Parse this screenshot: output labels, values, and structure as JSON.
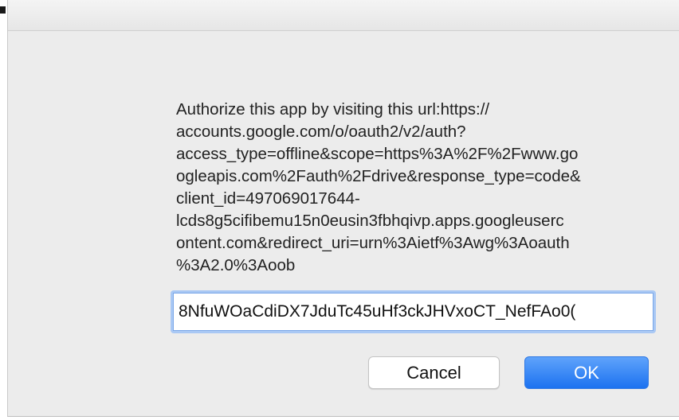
{
  "dialog": {
    "message": "Authorize this app by visiting this url:https://\naccounts.google.com/o/oauth2/v2/auth?\naccess_type=offline&scope=https%3A%2F%2Fwww.go\nogleapis.com%2Fauth%2Fdrive&response_type=code&\nclient_id=497069017644-\nlcds8g5cifibemu15n0eusin3fbhqivp.apps.googleuserc\nontent.com&redirect_uri=urn%3Aietf%3Awg%3Aoauth\n%3A2.0%3Aoob",
    "code_input": {
      "value": ")8NfuWOaCdiDX7JduTc45uHf3ckJHVxoCT_NefFAo0"
    },
    "buttons": {
      "cancel_label": "Cancel",
      "ok_label": "OK"
    }
  },
  "colors": {
    "dialog_background": "#ececec",
    "ok_button": "#1c72f0",
    "focus_ring": "#a9c8f4"
  }
}
